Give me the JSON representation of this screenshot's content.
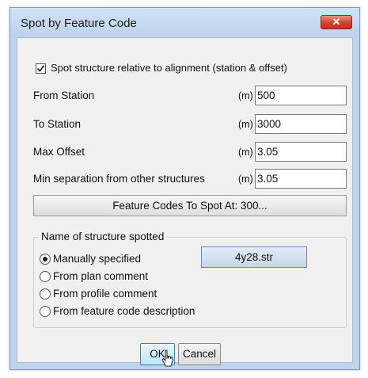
{
  "window": {
    "title": "Spot by Feature Code",
    "close_glyph": "✕"
  },
  "checkbox": {
    "label": "Spot structure relative to alignment (station & offset)",
    "checked": true
  },
  "fields": [
    {
      "label": "From Station",
      "unit": "(m)",
      "value": "500"
    },
    {
      "label": "To Station",
      "unit": "(m)",
      "value": "3000"
    },
    {
      "label": "Max Offset",
      "unit": "(m)",
      "value": "3.05"
    },
    {
      "label": "Min separation from other structures",
      "unit": "(m)",
      "value": "3.05"
    }
  ],
  "feature_codes_button": "Feature Codes To Spot At: 300...",
  "group": {
    "title": "Name of structure spotted",
    "options": [
      {
        "label": "Manually specified",
        "selected": true
      },
      {
        "label": "From plan comment",
        "selected": false
      },
      {
        "label": "From profile comment",
        "selected": false
      },
      {
        "label": "From feature code description",
        "selected": false
      }
    ],
    "structure_button": "4y28.str"
  },
  "buttons": {
    "ok": "OK",
    "cancel": "Cancel"
  },
  "icons": [
    "close-icon",
    "checkmark-icon",
    "mouse-cursor-icon"
  ]
}
